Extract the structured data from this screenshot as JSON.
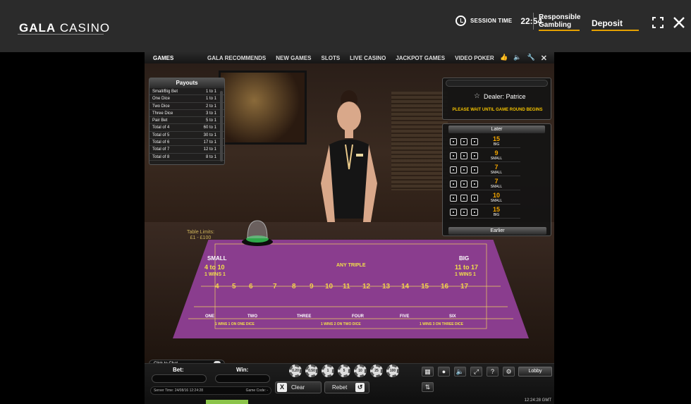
{
  "header": {
    "logo_bold": "GALA",
    "logo_light": "CASINO",
    "session_label": "SESSION TIME",
    "session_value": "22:54",
    "responsible": "Responsible Gambling",
    "deposit": "Deposit",
    "fullscreen_icon": "fullscreen-icon",
    "close_icon": "close-icon"
  },
  "nav": {
    "games": "GAMES",
    "items": [
      "GALA RECOMMENDS",
      "NEW GAMES",
      "SLOTS",
      "LIVE CASINO",
      "JACKPOT GAMES",
      "VIDEO POKER"
    ]
  },
  "payouts": {
    "title": "Payouts",
    "rows": [
      {
        "name": "Small/Big Bet",
        "odds": "1 to 1"
      },
      {
        "name": "One Dice",
        "odds": "1 to 1"
      },
      {
        "name": "Two Dice",
        "odds": "2 to 1"
      },
      {
        "name": "Three Dice",
        "odds": "3 to 1"
      },
      {
        "name": "Pair Bet",
        "odds": "5 to 1"
      },
      {
        "name": "Total of 4",
        "odds": "60 to 1"
      },
      {
        "name": "Total of 5",
        "odds": "30 to 1"
      },
      {
        "name": "Total of 6",
        "odds": "17 to 1"
      },
      {
        "name": "Total of 7",
        "odds": "12 to 1"
      },
      {
        "name": "Total of 8",
        "odds": "8 to 1"
      }
    ]
  },
  "dealer": {
    "name": "Dealer: Patrice",
    "status": "PLEASE WAIT UNTIL GAME ROUND BEGINS"
  },
  "history": {
    "later": "Later",
    "earlier": "Earlier",
    "rows": [
      {
        "total": "15",
        "label": "BIG"
      },
      {
        "total": "9",
        "label": "SMALL"
      },
      {
        "total": "7",
        "label": "SMALL"
      },
      {
        "total": "7",
        "label": "SMALL"
      },
      {
        "total": "10",
        "label": "SMALL"
      },
      {
        "total": "15",
        "label": "BIG"
      }
    ]
  },
  "table": {
    "limits_line1": "Table Limits:",
    "limits_line2": "£1 - £100",
    "small": "SMALL",
    "small_range": "4 to 10",
    "small_wins": "1 WINS 1",
    "big": "BIG",
    "big_range": "11 to 17",
    "big_wins": "1 WINS 1",
    "any_triple": "ANY TRIPLE",
    "totals": [
      "4",
      "5",
      "6",
      "7",
      "8",
      "9",
      "10",
      "11",
      "12",
      "13",
      "14",
      "15",
      "16",
      "17"
    ],
    "singles": [
      "ONE",
      "TWO",
      "THREE",
      "FOUR",
      "FIVE",
      "SIX"
    ],
    "one_dice": "1 WINS 1 ON ONE DICE",
    "two_dice": "1 WINS 2 ON TWO DICE",
    "three_dice": "1 WINS 3 ON THREE DICE"
  },
  "chat": {
    "label": "Click to Chat"
  },
  "controls": {
    "bet_label": "Bet:",
    "win_label": "Win:",
    "server_time": "Server Time: 24/08/16 12:24:28",
    "game_code": "Game Code: -",
    "chips": [
      "0.20",
      "0.50",
      "1",
      "5",
      "10",
      "25",
      "100"
    ],
    "clear": "Clear",
    "rebet": "Rebet",
    "lobby": "Lobby",
    "gmt": "12:24:28 GMT"
  }
}
